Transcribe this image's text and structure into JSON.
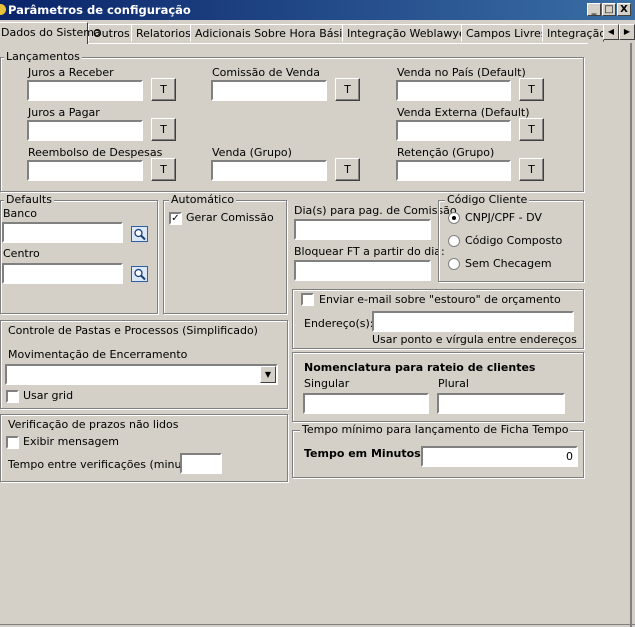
{
  "window": {
    "title": "Parâmetros de configuração",
    "minimize": "_",
    "maximize": "□",
    "close": "X"
  },
  "tabs": [
    "Dados do Sistema",
    "Outros",
    "Relatorios",
    "Adicionais Sobre Hora Básica",
    "Integração Weblawyer",
    "Campos Livres",
    "Integração"
  ],
  "lancamentos": {
    "legend": "Lançamentos",
    "juros_receber": "Juros a Receber",
    "juros_pagar": "Juros a Pagar",
    "reembolso": "Reembolso de Despesas",
    "comissao_venda": "Comissão de Venda",
    "venda_grupo": "Venda (Grupo)",
    "venda_pais": "Venda no País (Default)",
    "venda_externa": "Venda Externa (Default)",
    "retencao_grupo": "Retenção (Grupo)",
    "t_button": "T"
  },
  "defaults": {
    "legend": "Defaults",
    "banco": "Banco",
    "centro": "Centro"
  },
  "automatico": {
    "legend": "Automático",
    "gerar_comissao": "Gerar Comissão",
    "gerar_comissao_checked": true
  },
  "dias": {
    "dias_pag_comissao": "Dia(s) para pag. de Comissão",
    "bloquear_ft": "Bloquear FT a partir do dia:"
  },
  "codigo_cliente": {
    "legend": "Código Cliente",
    "options": [
      "CNPJ/CPF - DV",
      "Código Composto",
      "Sem Checagem"
    ],
    "selected": "CNPJ/CPF - DV"
  },
  "email": {
    "enviar": "Enviar e-mail sobre \"estouro\" de orçamento",
    "enderecos": "Endereço(s):",
    "hint": "Usar ponto e vírgula entre endereços"
  },
  "pastas": {
    "title": "Controle de Pastas e Processos (Simplificado)",
    "movimentacao": "Movimentação de Encerramento",
    "usar_grid": "Usar grid"
  },
  "nomenclatura": {
    "title": "Nomenclatura para rateio de clientes",
    "singular": "Singular",
    "plural": "Plural"
  },
  "verificacao": {
    "title": "Verificação de prazos não lidos",
    "exibir": "Exibir mensagem",
    "tempo_entre": "Tempo entre verificações (minutos):"
  },
  "tempo_minimo": {
    "legend": "Tempo mínimo para lançamento de Ficha Tempo",
    "label": "Tempo em Minutos",
    "value": "0"
  }
}
